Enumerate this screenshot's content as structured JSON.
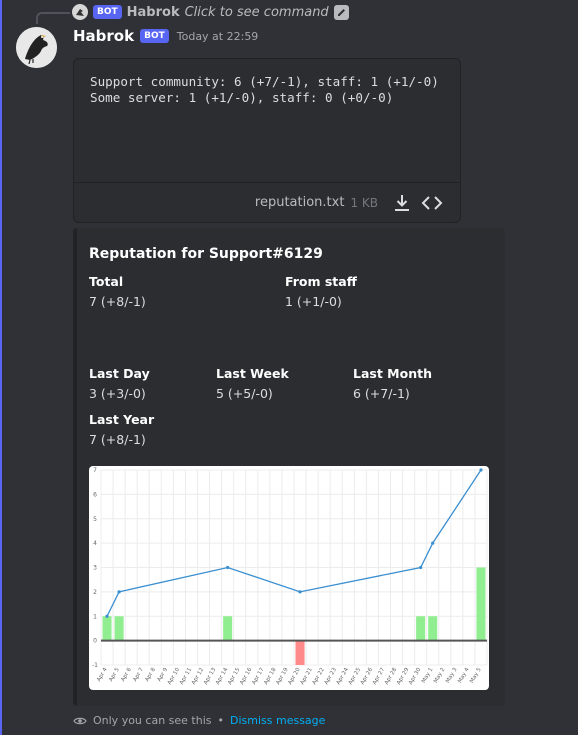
{
  "reply": {
    "bot_tag": "BOT",
    "name": "Habrok",
    "command_text": "Click to see command"
  },
  "message": {
    "username": "Habrok",
    "bot_tag": "BOT",
    "timestamp": "Today at 22:59"
  },
  "attachment": {
    "line1": "Support community: 6 (+7/-1), staff: 1 (+1/-0)",
    "line2": "Some server: 1 (+1/-0), staff: 0 (+0/-0)",
    "filename": "reputation.txt",
    "size": "1 KB"
  },
  "embed": {
    "title": "Reputation for Support#6129",
    "fields": [
      {
        "name": "Total",
        "value": "7 (+8/-1)"
      },
      {
        "name": "From staff",
        "value": "1 (+1/-0)"
      },
      {
        "name": "Last Day",
        "value": "3 (+3/-0)"
      },
      {
        "name": "Last Week",
        "value": "5 (+5/-0)"
      },
      {
        "name": "Last Month",
        "value": "6 (+7/-1)"
      },
      {
        "name": "Last Year",
        "value": "7 (+8/-1)"
      }
    ]
  },
  "ephemeral": {
    "text": "Only you can see this",
    "separator": "•",
    "dismiss": "Dismiss message"
  },
  "colors": {
    "accent": "#5865f2",
    "line": "#3a8fd1",
    "positive_bar": "#90ee90",
    "negative_bar": "#ff8a8a",
    "link": "#00aff4"
  },
  "chart_data": {
    "type": "bar",
    "categories": [
      "Apr 4",
      "Apr 5",
      "Apr 6",
      "Apr 7",
      "Apr 8",
      "Apr 9",
      "Apr 10",
      "Apr 11",
      "Apr 12",
      "Apr 13",
      "Apr 14",
      "Apr 15",
      "Apr 16",
      "Apr 17",
      "Apr 18",
      "Apr 19",
      "Apr 20",
      "Apr 21",
      "Apr 22",
      "Apr 23",
      "Apr 24",
      "Apr 25",
      "Apr 26",
      "Apr 27",
      "Apr 28",
      "Apr 29",
      "Apr 30",
      "May 1",
      "May 2",
      "May 3",
      "May 4",
      "May 5"
    ],
    "series": [
      {
        "type": "bar",
        "values": [
          1,
          1,
          0,
          0,
          0,
          0,
          0,
          0,
          0,
          0,
          1,
          0,
          0,
          0,
          0,
          0,
          -1,
          0,
          0,
          0,
          0,
          0,
          0,
          0,
          0,
          0,
          1,
          1,
          0,
          0,
          0,
          3
        ]
      },
      {
        "type": "line",
        "values": [
          1,
          2,
          2,
          2,
          2,
          2,
          2,
          2,
          2,
          2,
          3,
          3,
          3,
          3,
          3,
          3,
          2,
          2,
          2,
          2,
          2,
          2,
          2,
          2,
          2,
          2,
          3,
          4,
          5,
          6,
          6,
          7
        ]
      }
    ],
    "line_marker_points": [
      [
        0,
        1
      ],
      [
        1,
        2
      ],
      [
        10,
        3
      ],
      [
        16,
        2
      ],
      [
        26,
        3
      ],
      [
        27,
        4
      ],
      [
        31,
        7
      ]
    ],
    "yticks": [
      -1,
      0,
      1,
      2,
      3,
      4,
      5,
      6,
      7
    ],
    "ylim": [
      -1,
      7
    ],
    "grid": true,
    "legend": "none"
  }
}
